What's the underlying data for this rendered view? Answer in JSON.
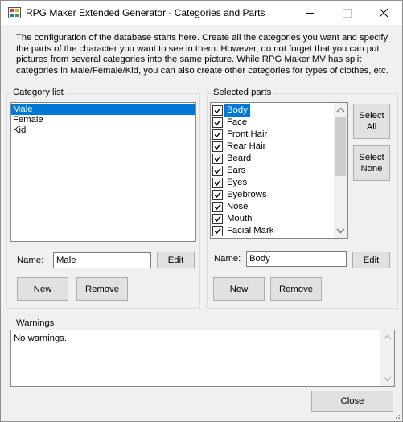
{
  "window": {
    "title": "RPG Maker Extended Generator - Categories and Parts",
    "controls": {
      "minimize": "—",
      "maximize": "☐",
      "close": "✕"
    }
  },
  "description": "The configuration of the database starts here. Create all the categories you want and specify the parts of the character you want to see in them. However, do not forget that you can put pictures from several categories into the same picture. While RPG Maker MV has split categories in Male/Female/Kid, you can also create other categories for types of clothes, etc.",
  "categories": {
    "label": "Category list",
    "items": [
      {
        "label": "Male",
        "selected": true
      },
      {
        "label": "Female",
        "selected": false
      },
      {
        "label": "Kid",
        "selected": false
      }
    ],
    "name_label": "Name:",
    "name_value": "Male",
    "edit_label": "Edit",
    "new_label": "New",
    "remove_label": "Remove"
  },
  "parts": {
    "label": "Selected parts",
    "items": [
      {
        "label": "Body",
        "checked": true,
        "selected": true
      },
      {
        "label": "Face",
        "checked": true,
        "selected": false
      },
      {
        "label": "Front Hair",
        "checked": true,
        "selected": false
      },
      {
        "label": "Rear Hair",
        "checked": true,
        "selected": false
      },
      {
        "label": "Beard",
        "checked": true,
        "selected": false
      },
      {
        "label": "Ears",
        "checked": true,
        "selected": false
      },
      {
        "label": "Eyes",
        "checked": true,
        "selected": false
      },
      {
        "label": "Eyebrows",
        "checked": true,
        "selected": false
      },
      {
        "label": "Nose",
        "checked": true,
        "selected": false
      },
      {
        "label": "Mouth",
        "checked": true,
        "selected": false
      },
      {
        "label": "Facial Mark",
        "checked": true,
        "selected": false
      }
    ],
    "select_all_line1": "Select",
    "select_all_line2": "All",
    "select_none_line1": "Select",
    "select_none_line2": "None",
    "name_label": "Name:",
    "name_value": "Body",
    "edit_label": "Edit",
    "new_label": "New",
    "remove_label": "Remove"
  },
  "warnings": {
    "label": "Warnings",
    "text": "No warnings."
  },
  "close_label": "Close"
}
